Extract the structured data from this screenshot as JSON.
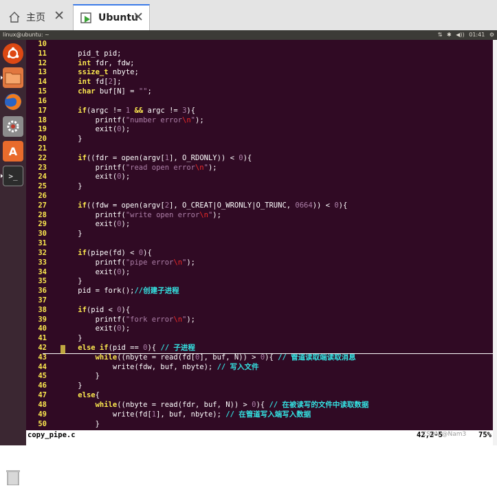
{
  "browser": {
    "tabs": [
      {
        "label": "主页",
        "icon": "home-icon",
        "close": "✕"
      },
      {
        "label": "Ubuntu",
        "icon": "vm-icon",
        "close": "✕"
      }
    ]
  },
  "topbar": {
    "window_title": "linux@ubuntu: ~",
    "indicators": "⇅ ✱ ◀)) 01:41 ⚙"
  },
  "launcher": {
    "items": [
      "ubuntu-logo-icon",
      "files-icon",
      "firefox-icon",
      "system-settings-icon",
      "software-center-icon",
      "terminal-icon",
      "trash-icon"
    ]
  },
  "editor": {
    "lines": [
      {
        "n": "10",
        "t": [
          {
            "c": "txt",
            "s": ""
          }
        ]
      },
      {
        "n": "11",
        "t": [
          {
            "c": "txt",
            "s": "    pid_t pid;"
          }
        ]
      },
      {
        "n": "12",
        "t": [
          {
            "c": "txt",
            "s": "    "
          },
          {
            "c": "kw",
            "s": "int"
          },
          {
            "c": "txt",
            "s": " fdr, fdw;"
          }
        ]
      },
      {
        "n": "13",
        "t": [
          {
            "c": "txt",
            "s": "    "
          },
          {
            "c": "kw",
            "s": "ssize_t"
          },
          {
            "c": "txt",
            "s": " nbyte;"
          }
        ]
      },
      {
        "n": "14",
        "t": [
          {
            "c": "txt",
            "s": "    "
          },
          {
            "c": "kw",
            "s": "int"
          },
          {
            "c": "txt",
            "s": " fd["
          },
          {
            "c": "num",
            "s": "2"
          },
          {
            "c": "txt",
            "s": "];"
          }
        ]
      },
      {
        "n": "15",
        "t": [
          {
            "c": "txt",
            "s": "    "
          },
          {
            "c": "kw",
            "s": "char"
          },
          {
            "c": "txt",
            "s": " buf[N] = "
          },
          {
            "c": "str",
            "s": "\"\""
          },
          {
            "c": "txt",
            "s": ";"
          }
        ]
      },
      {
        "n": "16",
        "t": [
          {
            "c": "txt",
            "s": ""
          }
        ]
      },
      {
        "n": "17",
        "t": [
          {
            "c": "txt",
            "s": "    "
          },
          {
            "c": "kw",
            "s": "if"
          },
          {
            "c": "txt",
            "s": "(argc != "
          },
          {
            "c": "num",
            "s": "1"
          },
          {
            "c": "txt",
            "s": " "
          },
          {
            "c": "kw",
            "s": "&&"
          },
          {
            "c": "txt",
            "s": " argc != "
          },
          {
            "c": "num",
            "s": "3"
          },
          {
            "c": "txt",
            "s": "){"
          }
        ]
      },
      {
        "n": "18",
        "t": [
          {
            "c": "txt",
            "s": "        printf("
          },
          {
            "c": "str",
            "s": "\"number error"
          },
          {
            "c": "esc",
            "s": "\\n"
          },
          {
            "c": "str",
            "s": "\""
          },
          {
            "c": "txt",
            "s": ");"
          }
        ]
      },
      {
        "n": "19",
        "t": [
          {
            "c": "txt",
            "s": "        exit("
          },
          {
            "c": "num",
            "s": "0"
          },
          {
            "c": "txt",
            "s": ");"
          }
        ]
      },
      {
        "n": "20",
        "t": [
          {
            "c": "txt",
            "s": "    }"
          }
        ]
      },
      {
        "n": "21",
        "t": [
          {
            "c": "txt",
            "s": ""
          }
        ]
      },
      {
        "n": "22",
        "t": [
          {
            "c": "txt",
            "s": "    "
          },
          {
            "c": "kw",
            "s": "if"
          },
          {
            "c": "txt",
            "s": "((fdr = open(argv["
          },
          {
            "c": "num",
            "s": "1"
          },
          {
            "c": "txt",
            "s": "], O_RDONLY)) < "
          },
          {
            "c": "num",
            "s": "0"
          },
          {
            "c": "txt",
            "s": "){"
          }
        ]
      },
      {
        "n": "23",
        "t": [
          {
            "c": "txt",
            "s": "        printf("
          },
          {
            "c": "str",
            "s": "\"read open error"
          },
          {
            "c": "esc",
            "s": "\\n"
          },
          {
            "c": "str",
            "s": "\""
          },
          {
            "c": "txt",
            "s": ");"
          }
        ]
      },
      {
        "n": "24",
        "t": [
          {
            "c": "txt",
            "s": "        exit("
          },
          {
            "c": "num",
            "s": "0"
          },
          {
            "c": "txt",
            "s": ");"
          }
        ]
      },
      {
        "n": "25",
        "t": [
          {
            "c": "txt",
            "s": "    }"
          }
        ]
      },
      {
        "n": "26",
        "t": [
          {
            "c": "txt",
            "s": ""
          }
        ]
      },
      {
        "n": "27",
        "t": [
          {
            "c": "txt",
            "s": "    "
          },
          {
            "c": "kw",
            "s": "if"
          },
          {
            "c": "txt",
            "s": "((fdw = open(argv["
          },
          {
            "c": "num",
            "s": "2"
          },
          {
            "c": "txt",
            "s": "], O_CREAT|O_WRONLY|O_TRUNC, "
          },
          {
            "c": "num",
            "s": "0664"
          },
          {
            "c": "txt",
            "s": ")) < "
          },
          {
            "c": "num",
            "s": "0"
          },
          {
            "c": "txt",
            "s": "){"
          }
        ]
      },
      {
        "n": "28",
        "t": [
          {
            "c": "txt",
            "s": "        printf("
          },
          {
            "c": "str",
            "s": "\"write open error"
          },
          {
            "c": "esc",
            "s": "\\n"
          },
          {
            "c": "str",
            "s": "\""
          },
          {
            "c": "txt",
            "s": ");"
          }
        ]
      },
      {
        "n": "29",
        "t": [
          {
            "c": "txt",
            "s": "        exit("
          },
          {
            "c": "num",
            "s": "0"
          },
          {
            "c": "txt",
            "s": ");"
          }
        ]
      },
      {
        "n": "30",
        "t": [
          {
            "c": "txt",
            "s": "    }"
          }
        ]
      },
      {
        "n": "31",
        "t": [
          {
            "c": "txt",
            "s": ""
          }
        ]
      },
      {
        "n": "32",
        "t": [
          {
            "c": "txt",
            "s": "    "
          },
          {
            "c": "kw",
            "s": "if"
          },
          {
            "c": "txt",
            "s": "(pipe(fd) < "
          },
          {
            "c": "num",
            "s": "0"
          },
          {
            "c": "txt",
            "s": "){"
          }
        ]
      },
      {
        "n": "33",
        "t": [
          {
            "c": "txt",
            "s": "        printf("
          },
          {
            "c": "str",
            "s": "\"pipe error"
          },
          {
            "c": "esc",
            "s": "\\n"
          },
          {
            "c": "str",
            "s": "\""
          },
          {
            "c": "txt",
            "s": ");"
          }
        ]
      },
      {
        "n": "34",
        "t": [
          {
            "c": "txt",
            "s": "        exit("
          },
          {
            "c": "num",
            "s": "0"
          },
          {
            "c": "txt",
            "s": ");"
          }
        ]
      },
      {
        "n": "35",
        "t": [
          {
            "c": "txt",
            "s": "    }"
          }
        ]
      },
      {
        "n": "36",
        "t": [
          {
            "c": "txt",
            "s": "    pid = fork();"
          },
          {
            "c": "cm",
            "s": "//创建子进程"
          }
        ]
      },
      {
        "n": "37",
        "t": [
          {
            "c": "txt",
            "s": ""
          }
        ]
      },
      {
        "n": "38",
        "t": [
          {
            "c": "txt",
            "s": "    "
          },
          {
            "c": "kw",
            "s": "if"
          },
          {
            "c": "txt",
            "s": "(pid < "
          },
          {
            "c": "num",
            "s": "0"
          },
          {
            "c": "txt",
            "s": "){"
          }
        ]
      },
      {
        "n": "39",
        "t": [
          {
            "c": "txt",
            "s": "        printf("
          },
          {
            "c": "str",
            "s": "\"fork error"
          },
          {
            "c": "esc",
            "s": "\\n"
          },
          {
            "c": "str",
            "s": "\""
          },
          {
            "c": "txt",
            "s": ");"
          }
        ]
      },
      {
        "n": "40",
        "t": [
          {
            "c": "txt",
            "s": "        exit("
          },
          {
            "c": "num",
            "s": "0"
          },
          {
            "c": "txt",
            "s": ");"
          }
        ]
      },
      {
        "n": "41",
        "t": [
          {
            "c": "txt",
            "s": "    }"
          }
        ]
      },
      {
        "n": "42",
        "t": [
          {
            "c": "txt",
            "s": "    "
          },
          {
            "c": "kw",
            "s": "else if"
          },
          {
            "c": "txt",
            "s": "(pid == "
          },
          {
            "c": "num",
            "s": "0"
          },
          {
            "c": "txt",
            "s": "){ "
          },
          {
            "c": "cm",
            "s": "// 子进程"
          }
        ]
      },
      {
        "n": "43",
        "t": [
          {
            "c": "txt",
            "s": "        "
          },
          {
            "c": "kw",
            "s": "while"
          },
          {
            "c": "txt",
            "s": "((nbyte = read(fd["
          },
          {
            "c": "num",
            "s": "0"
          },
          {
            "c": "txt",
            "s": "], buf, N)) > "
          },
          {
            "c": "num",
            "s": "0"
          },
          {
            "c": "txt",
            "s": "){ "
          },
          {
            "c": "cm",
            "s": "// 管道读取端读取消息"
          }
        ]
      },
      {
        "n": "44",
        "t": [
          {
            "c": "txt",
            "s": "            write(fdw, buf, nbyte); "
          },
          {
            "c": "cm",
            "s": "// 写入文件"
          }
        ]
      },
      {
        "n": "45",
        "t": [
          {
            "c": "txt",
            "s": "        }"
          }
        ]
      },
      {
        "n": "46",
        "t": [
          {
            "c": "txt",
            "s": "    }"
          }
        ]
      },
      {
        "n": "47",
        "t": [
          {
            "c": "txt",
            "s": "    "
          },
          {
            "c": "kw",
            "s": "else"
          },
          {
            "c": "txt",
            "s": "{"
          }
        ]
      },
      {
        "n": "48",
        "t": [
          {
            "c": "txt",
            "s": "        "
          },
          {
            "c": "kw",
            "s": "while"
          },
          {
            "c": "txt",
            "s": "((nbyte = read(fdr, buf, N)) > "
          },
          {
            "c": "num",
            "s": "0"
          },
          {
            "c": "txt",
            "s": "){ "
          },
          {
            "c": "cm",
            "s": "// 在被读写的文件中读取数据"
          }
        ]
      },
      {
        "n": "49",
        "t": [
          {
            "c": "txt",
            "s": "            write(fd["
          },
          {
            "c": "num",
            "s": "1"
          },
          {
            "c": "txt",
            "s": "], buf, nbyte); "
          },
          {
            "c": "cm",
            "s": "// 在管道写入端写入数据"
          }
        ]
      },
      {
        "n": "50",
        "t": [
          {
            "c": "txt",
            "s": "        }"
          }
        ]
      }
    ]
  },
  "statusbar": {
    "filename": "copy_pipe.c",
    "position": "42,2-5",
    "percent": "75%"
  },
  "watermark": "CSDN @Nam3"
}
